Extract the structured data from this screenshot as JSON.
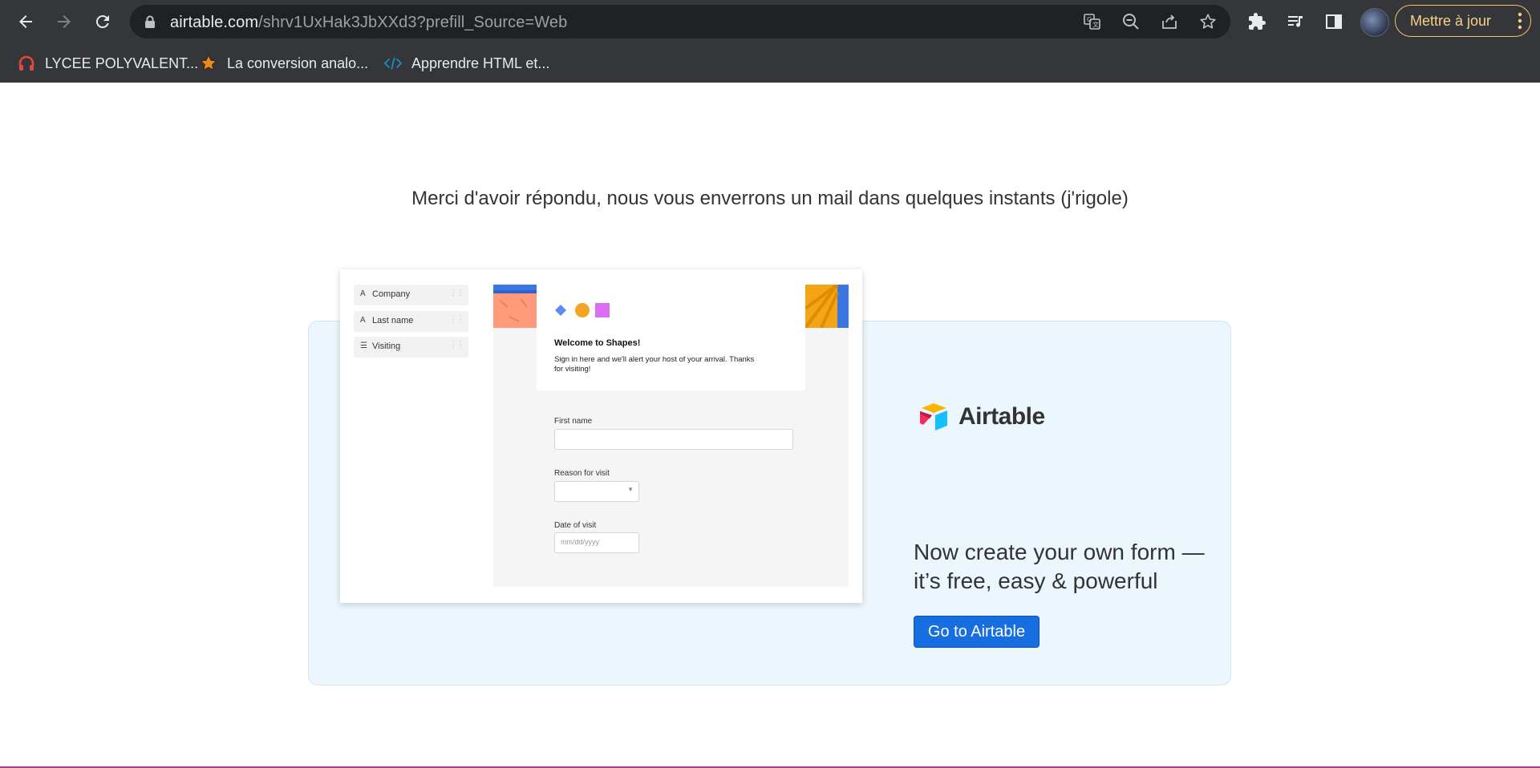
{
  "browser": {
    "url_host": "airtable.com",
    "url_path": "/shrv1UxHak3JbXXd3?prefill_Source=Web",
    "update_button": "Mettre à jour",
    "bookmarks": [
      {
        "label": "LYCEE POLYVALENT...",
        "icon": "headphones-icon"
      },
      {
        "label": "La conversion analo...",
        "icon": "star-icon"
      },
      {
        "label": "Apprendre HTML et...",
        "icon": "code-icon"
      }
    ]
  },
  "page": {
    "thanks_message": "Merci d'avoir répondu, nous vous enverrons un mail dans quelques instants (j'rigole)",
    "mock_form": {
      "fields": [
        "Company",
        "Last name",
        "Visiting"
      ],
      "welcome_title": "Welcome to Shapes!",
      "welcome_desc": "Sign in here and we'll alert your host of your arrival. Thanks for visiting!",
      "first_name_label": "First name",
      "reason_label": "Reason for visit",
      "date_label": "Date of visit",
      "date_placeholder": "mm/dd/yyyy"
    },
    "brand_name": "Airtable",
    "cta_text": "Now create your own form — it’s free, easy & powerful",
    "cta_button": "Go to Airtable"
  },
  "colors": {
    "chrome_bg": "#35363a",
    "omnibox_bg": "#202124",
    "update_accent": "#f3c26b",
    "promo_bg": "#ecf6fd",
    "cta_button": "#166ee1"
  }
}
